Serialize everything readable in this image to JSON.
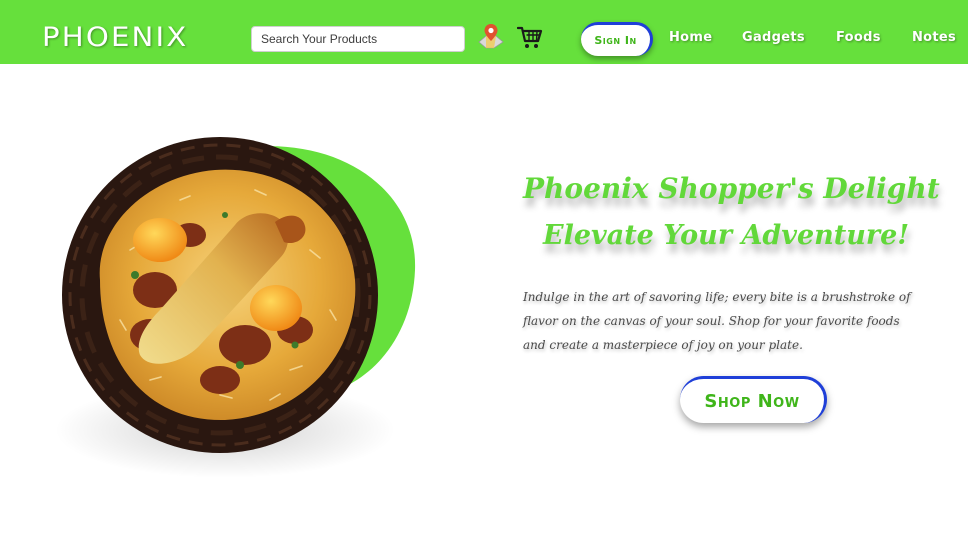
{
  "header": {
    "logo": "PHOENIX",
    "search_placeholder": "Search Your Products",
    "signin_label": "Sign In",
    "nav": [
      {
        "label": "Home"
      },
      {
        "label": "Gadgets"
      },
      {
        "label": "Foods"
      },
      {
        "label": "Notes"
      }
    ],
    "icons": [
      "map-location-icon",
      "shopping-cart-icon"
    ]
  },
  "hero": {
    "headline_line1": "Phoenix Shopper's Delight",
    "headline_line2": "Elevate Your Adventure!",
    "tagline": "Indulge in the art of savoring life; every bite is a brushstroke of flavor on the canvas of your soul. Shop for your favorite foods and create a masterpiece of joy on your plate.",
    "cta_label": "Shop Now",
    "image": "biryani-plate"
  },
  "colors": {
    "brand_green": "#66e03c",
    "headline_green": "#62d83a",
    "button_accent_blue": "#1f3fd8",
    "button_text_green": "#3fb51a"
  }
}
